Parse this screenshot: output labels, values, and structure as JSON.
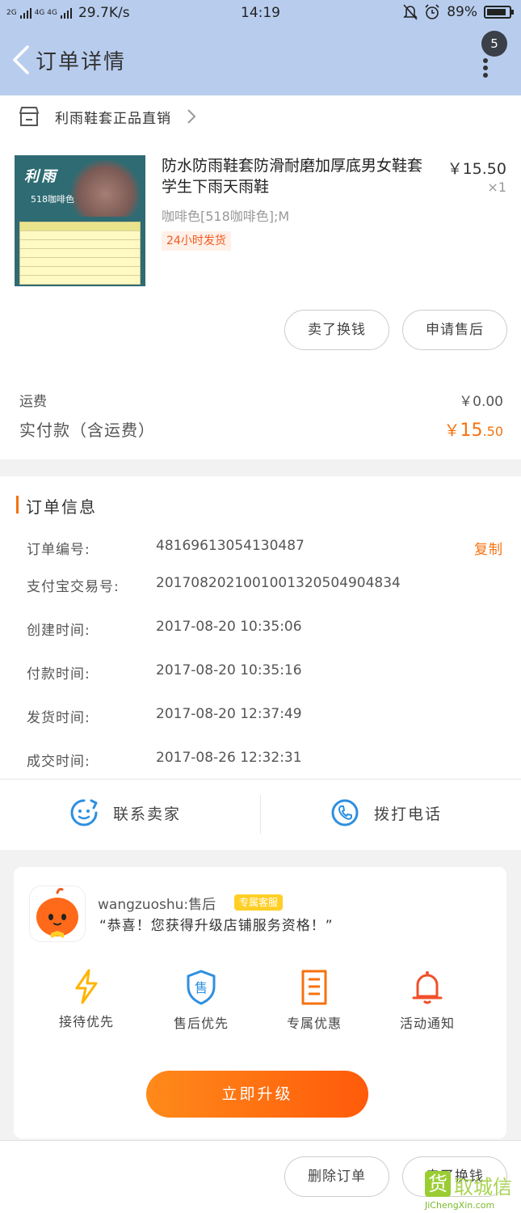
{
  "status_bar": {
    "net_top": "2G",
    "net_mid": "4G 4G",
    "speed": "29.7K/s",
    "time": "14:19",
    "battery": "89%",
    "battery_level": 0.89
  },
  "nav": {
    "title": "订单详情",
    "badge": "5"
  },
  "shop": {
    "name": "利雨鞋套正品直销"
  },
  "product": {
    "thumb_brand": "利雨",
    "thumb_color": "518咖啡色",
    "title": "防水防雨鞋套防滑耐磨加厚底男女鞋套学生下雨天雨鞋",
    "price": "￥15.50",
    "qty": "×1",
    "sku": "咖啡色[518咖啡色];M",
    "tag": "24小时发货"
  },
  "product_buttons": {
    "sell": "卖了换钱",
    "after_sale": "申请售后"
  },
  "fees": {
    "shipping_label": "运费",
    "shipping_value": "￥0.00",
    "paid_label": "实付款（含运费）",
    "paid_symbol": "￥",
    "paid_int": "15",
    "paid_dec": ".50"
  },
  "order_info": {
    "title": "订单信息",
    "copy_label": "复制",
    "rows": [
      {
        "key": "订单编号:",
        "value": "48169613054130487"
      },
      {
        "key": "支付宝交易号:",
        "value": "2017082021001001320504904834"
      },
      {
        "key": "创建时间:",
        "value": "2017-08-20 10:35:06"
      },
      {
        "key": "付款时间:",
        "value": "2017-08-20 10:35:16"
      },
      {
        "key": "发货时间:",
        "value": "2017-08-20 12:37:49"
      },
      {
        "key": "成交时间:",
        "value": "2017-08-26 12:32:31"
      }
    ],
    "contact_seller": "联系卖家",
    "call_phone": "拨打电话"
  },
  "service": {
    "name": "wangzuoshu:售后",
    "tag": "专属客服",
    "message": "“恭喜！您获得升级店铺服务资格！”",
    "perks": [
      "接待优先",
      "售后优先",
      "专属优惠",
      "活动通知"
    ],
    "perk_badge": "售",
    "upgrade": "立即升级"
  },
  "bottom": {
    "delete": "删除订单",
    "sell": "卖了换钱"
  },
  "watermark": {
    "logo": "货",
    "text": "取城信",
    "url": "JiChengXin.com"
  },
  "colors": {
    "accent": "#f5720f",
    "header": "#b8cdee",
    "blue_icon": "#2e8fe0"
  }
}
